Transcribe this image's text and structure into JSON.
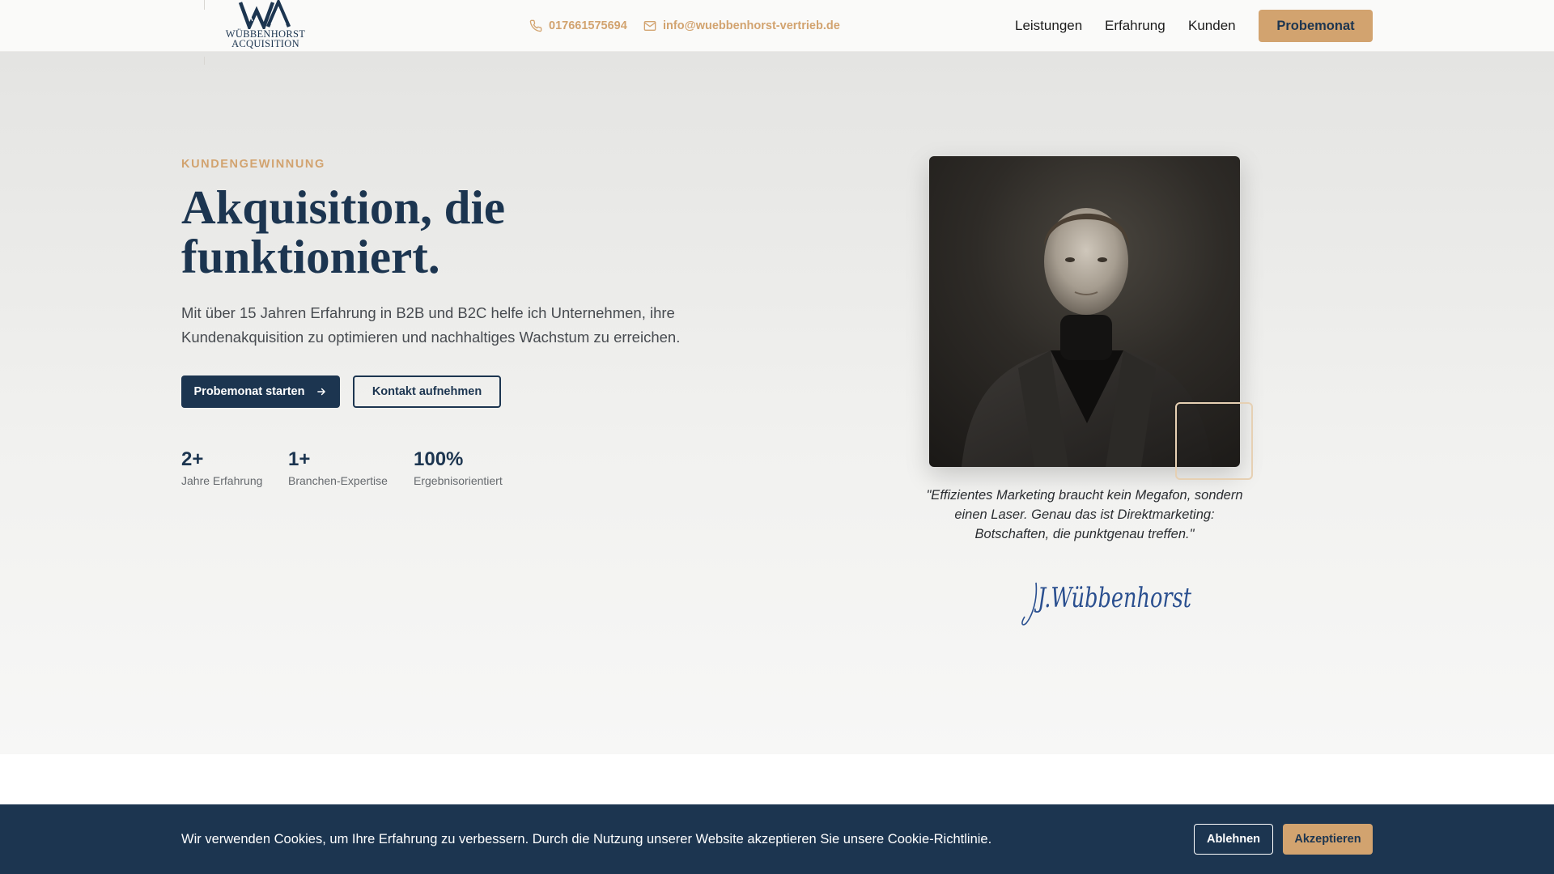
{
  "header": {
    "logo": {
      "line1": "WÜBBENHORST",
      "line2": "ACQUISITION",
      "icon": "wa-monogram-icon"
    },
    "phone": {
      "icon": "phone-icon",
      "text": "017661575694"
    },
    "email": {
      "icon": "mail-icon",
      "text": "info@wuebbenhorst-vertrieb.de"
    },
    "nav": [
      "Leistungen",
      "Erfahrung",
      "Kunden"
    ],
    "cta": "Probemonat"
  },
  "hero": {
    "eyebrow": "KUNDENGEWINNUNG",
    "title_line1": "Akquisition, die",
    "title_line2": "funktioniert.",
    "lead": "Mit über 15 Jahren Erfahrung in B2B und B2C helfe ich Unternehmen, ihre Kundenakquisition zu optimieren und nachhaltiges Wachstum zu erreichen.",
    "primary_button": "Probemonat starten",
    "primary_button_icon": "arrow-right-icon",
    "secondary_button": "Kontakt aufnehmen",
    "stats": [
      {
        "value": "2+",
        "label": "Jahre Erfahrung"
      },
      {
        "value": "1+",
        "label": "Branchen-Expertise"
      },
      {
        "value": "100%",
        "label": "Ergebnisorientiert"
      }
    ],
    "quote": "\"Effizientes Marketing braucht kein Megafon, sondern einen Laser. Genau das ist Direktmarketing: Botschaften, die punktgenau treffen.\"",
    "signature": "J.Wübbenhorst"
  },
  "cookie": {
    "text": "Wir verwenden Cookies, um Ihre Erfahrung zu verbessern. Durch die Nutzung unserer Website akzeptieren Sie unsere Cookie-Richtlinie.",
    "decline": "Ablehnen",
    "accept": "Akzeptieren"
  },
  "colors": {
    "navy": "#1c3550",
    "gold": "#d2a36f",
    "signature_blue": "#2a4f8f"
  }
}
